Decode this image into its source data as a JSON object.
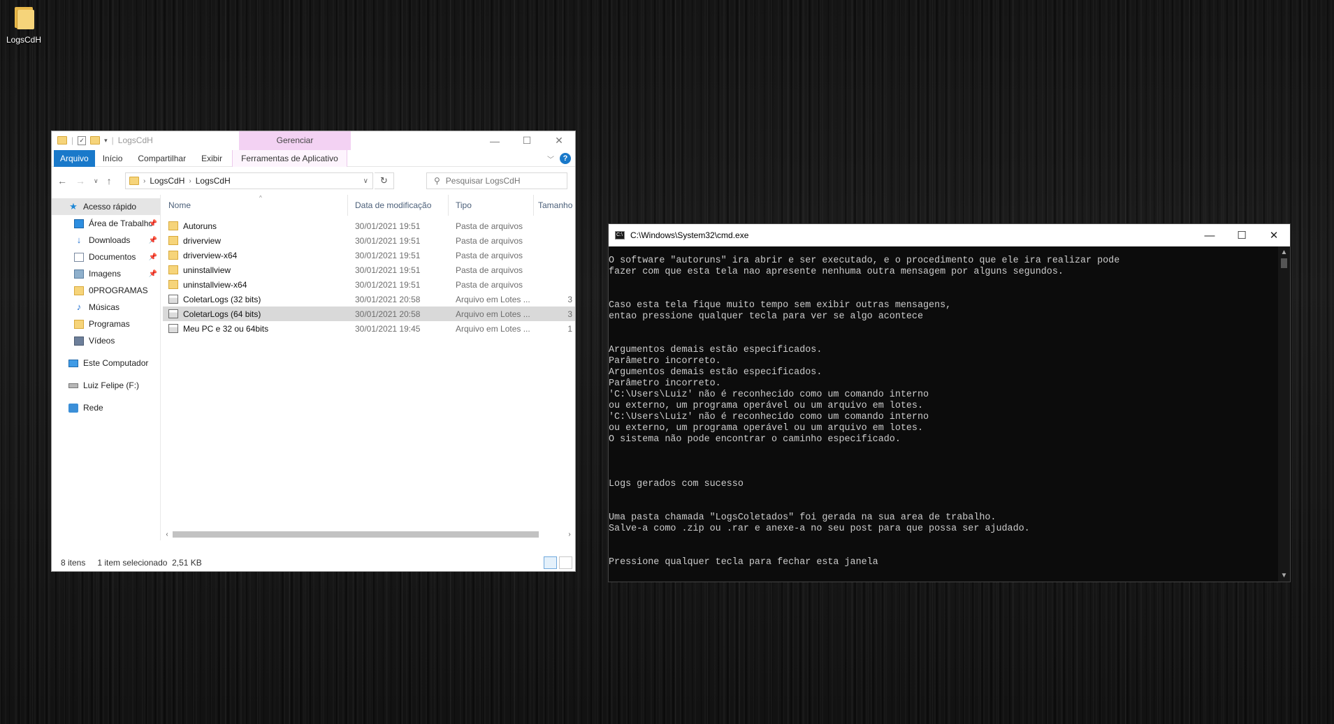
{
  "desktop": {
    "icons": [
      {
        "label": "LogsCdH",
        "icon": "folder-icon"
      }
    ]
  },
  "explorer": {
    "title": "LogsCdH",
    "manage_tab": "Gerenciar",
    "ribbon_tabs": [
      "Arquivo",
      "Início",
      "Compartilhar",
      "Exibir",
      "Ferramentas de Aplicativo"
    ],
    "breadcrumb": [
      "LogsCdH",
      "LogsCdH"
    ],
    "search_placeholder": "Pesquisar LogsCdH",
    "nav_pane": [
      {
        "label": "Acesso rápido",
        "icon": "star-icon",
        "pinned": false,
        "selected": true
      },
      {
        "label": "Área de Trabalho",
        "icon": "desktop-icon",
        "pinned": true
      },
      {
        "label": "Downloads",
        "icon": "download-icon",
        "pinned": true
      },
      {
        "label": "Documentos",
        "icon": "document-icon",
        "pinned": true
      },
      {
        "label": "Imagens",
        "icon": "image-icon",
        "pinned": true
      },
      {
        "label": "0PROGRAMAS",
        "icon": "folder-icon",
        "pinned": false
      },
      {
        "label": "Músicas",
        "icon": "music-icon",
        "pinned": false
      },
      {
        "label": "Programas",
        "icon": "folder-icon",
        "pinned": false
      },
      {
        "label": "Vídeos",
        "icon": "video-icon",
        "pinned": false
      },
      {
        "label": "Este Computador",
        "icon": "computer-icon",
        "pinned": false
      },
      {
        "label": "Luiz Felipe (F:)",
        "icon": "drive-icon",
        "pinned": false
      },
      {
        "label": "Rede",
        "icon": "network-icon",
        "pinned": false
      }
    ],
    "columns": [
      "Nome",
      "Data de modificação",
      "Tipo",
      "Tamanho"
    ],
    "files": [
      {
        "name": "Autoruns",
        "date": "30/01/2021 19:51",
        "type": "Pasta de arquivos",
        "size": "",
        "icon": "folder-icon",
        "selected": false
      },
      {
        "name": "driverview",
        "date": "30/01/2021 19:51",
        "type": "Pasta de arquivos",
        "size": "",
        "icon": "folder-icon",
        "selected": false
      },
      {
        "name": "driverview-x64",
        "date": "30/01/2021 19:51",
        "type": "Pasta de arquivos",
        "size": "",
        "icon": "folder-icon",
        "selected": false
      },
      {
        "name": "uninstallview",
        "date": "30/01/2021 19:51",
        "type": "Pasta de arquivos",
        "size": "",
        "icon": "folder-icon",
        "selected": false
      },
      {
        "name": "uninstallview-x64",
        "date": "30/01/2021 19:51",
        "type": "Pasta de arquivos",
        "size": "",
        "icon": "folder-icon",
        "selected": false
      },
      {
        "name": "ColetarLogs (32 bits)",
        "date": "30/01/2021 20:58",
        "type": "Arquivo em Lotes ...",
        "size": "3",
        "icon": "batch-file-icon",
        "selected": false
      },
      {
        "name": "ColetarLogs (64 bits)",
        "date": "30/01/2021 20:58",
        "type": "Arquivo em Lotes ...",
        "size": "3",
        "icon": "batch-file-icon",
        "selected": true
      },
      {
        "name": "Meu PC e 32 ou 64bits",
        "date": "30/01/2021 19:45",
        "type": "Arquivo em Lotes ...",
        "size": "1",
        "icon": "batch-file-icon",
        "selected": false
      }
    ],
    "status": {
      "count": "8 itens",
      "selection": "1 item selecionado",
      "size": "2,51 KB"
    }
  },
  "cmd": {
    "title": "C:\\Windows\\System32\\cmd.exe",
    "lines": [
      "O software \"autoruns\" ira abrir e ser executado, e o procedimento que ele ira realizar pode",
      "fazer com que esta tela nao apresente nenhuma outra mensagem por alguns segundos.",
      "",
      "",
      "Caso esta tela fique muito tempo sem exibir outras mensagens,",
      "entao pressione qualquer tecla para ver se algo acontece",
      "",
      "",
      "Argumentos demais estão especificados.",
      "Parâmetro incorreto.",
      "Argumentos demais estão especificados.",
      "Parâmetro incorreto.",
      "'C:\\Users\\Luiz' não é reconhecido como um comando interno",
      "ou externo, um programa operável ou um arquivo em lotes.",
      "'C:\\Users\\Luiz' não é reconhecido como um comando interno",
      "ou externo, um programa operável ou um arquivo em lotes.",
      "O sistema não pode encontrar o caminho especificado.",
      "",
      "",
      "",
      "Logs gerados com sucesso",
      "",
      "",
      "Uma pasta chamada \"LogsColetados\" foi gerada na sua area de trabalho.",
      "Salve-a como .zip ou .rar e anexe-a no seu post para que possa ser ajudado.",
      "",
      "",
      "Pressione qualquer tecla para fechar esta janela"
    ]
  }
}
